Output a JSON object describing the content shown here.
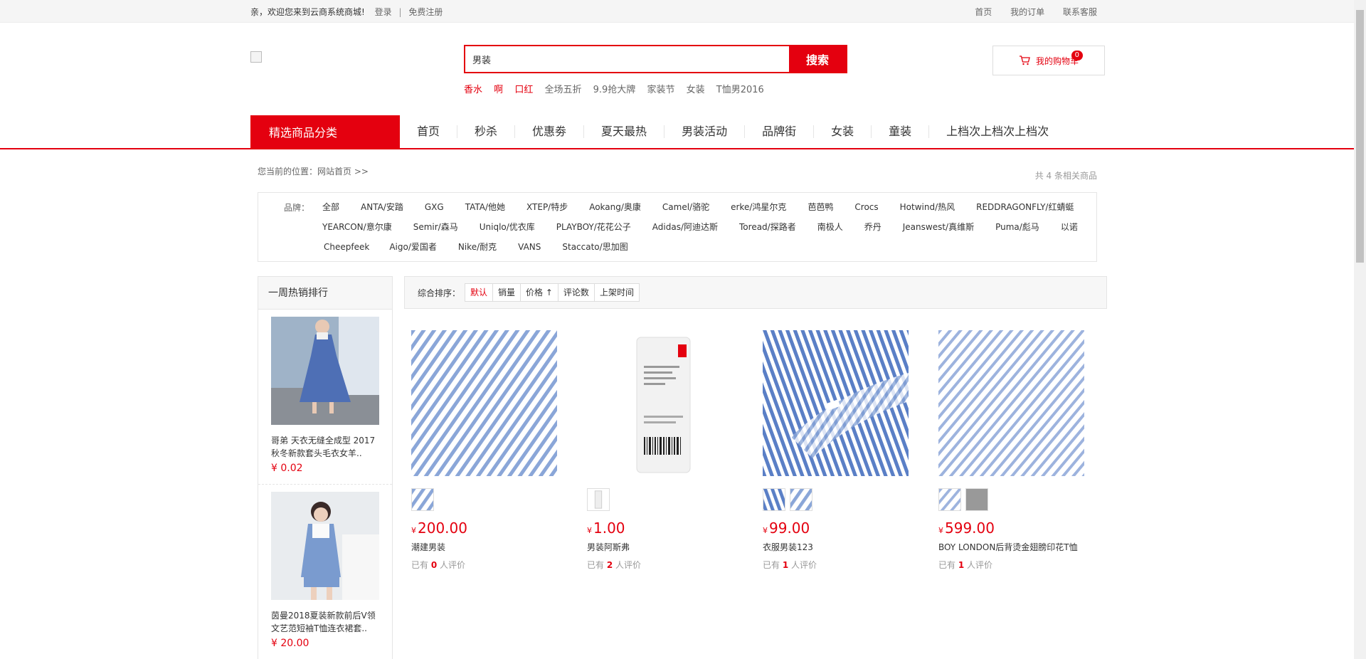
{
  "topbar": {
    "welcome": "亲，欢迎您来到云商系统商城!",
    "login": "登录",
    "sep": "|",
    "register": "免费注册",
    "links": [
      "首页",
      "我的订单",
      "联系客服"
    ]
  },
  "search": {
    "value": "男装",
    "button": "搜索",
    "hot": [
      {
        "text": "香水",
        "red": true
      },
      {
        "text": "啊",
        "red": true
      },
      {
        "text": "口红",
        "red": true
      },
      {
        "text": "全场五折",
        "red": false
      },
      {
        "text": "9.9抢大牌",
        "red": false
      },
      {
        "text": "家装节",
        "red": false
      },
      {
        "text": "女装",
        "red": false
      },
      {
        "text": "T恤男2016",
        "red": false
      }
    ]
  },
  "cart": {
    "label": "我的购物车",
    "count": "0"
  },
  "nav": {
    "category": "精选商品分类",
    "items": [
      "首页",
      "秒杀",
      "优惠劵",
      "夏天最热",
      "男装活动",
      "品牌街",
      "女装",
      "童装",
      "上档次上档次上档次"
    ]
  },
  "breadcrumb": {
    "label": "您当前的位置：",
    "path": "网站首页 >>",
    "count": "共 4 条相关商品"
  },
  "filter": {
    "label": "品牌：",
    "brands": [
      "全部",
      "ANTA/安踏",
      "GXG",
      "TATA/他她",
      "XTEP/特步",
      "Aokang/奥康",
      "Camel/骆驼",
      "erke/鸿星尔克",
      "芭芭鸭",
      "Crocs",
      "Hotwind/热风",
      "REDDRAGONFLY/红蜻蜓",
      "YEARCON/意尔康",
      "Semir/森马",
      "Uniqlo/优衣库",
      "PLAYBOY/花花公子",
      "Adidas/阿迪达斯",
      "Toread/探路者",
      "南极人",
      "乔丹",
      "Jeanswest/真维斯",
      "Puma/彪马",
      "以诺",
      "Cheepfeek",
      "Aigo/爱国者",
      "Nike/耐克",
      "VANS",
      "Staccato/思加图"
    ]
  },
  "sidebar": {
    "title": "一周热销排行",
    "items": [
      {
        "title": "哥弟 天衣无缝全成型 2017秋冬新款套头毛衣女羊..",
        "price": "¥ 0.02"
      },
      {
        "title": "茵曼2018夏装新款前后V领文艺范短袖T恤连衣裙套..",
        "price": "¥ 20.00"
      }
    ]
  },
  "sort": {
    "label": "综合排序：",
    "options": [
      "默认",
      "销量",
      "价格 ↑",
      "评论数",
      "上架时间"
    ]
  },
  "products": [
    {
      "currency": "¥",
      "price": "200.00",
      "name": "潮建男装",
      "review_pre": "已有",
      "review_count": "0",
      "review_post": "人评价"
    },
    {
      "currency": "¥",
      "price": "1.00",
      "name": "男装阿斯弗",
      "review_pre": "已有",
      "review_count": "2",
      "review_post": "人评价"
    },
    {
      "currency": "¥",
      "price": "99.00",
      "name": "衣服男装123",
      "review_pre": "已有",
      "review_count": "1",
      "review_post": "人评价"
    },
    {
      "currency": "¥",
      "price": "599.00",
      "name": "BOY LONDON后背烫金翅膀印花T恤",
      "review_pre": "已有",
      "review_count": "1",
      "review_post": "人评价"
    }
  ],
  "colors": {
    "accent": "#e4000f",
    "stripe": "#8aa6d8"
  }
}
